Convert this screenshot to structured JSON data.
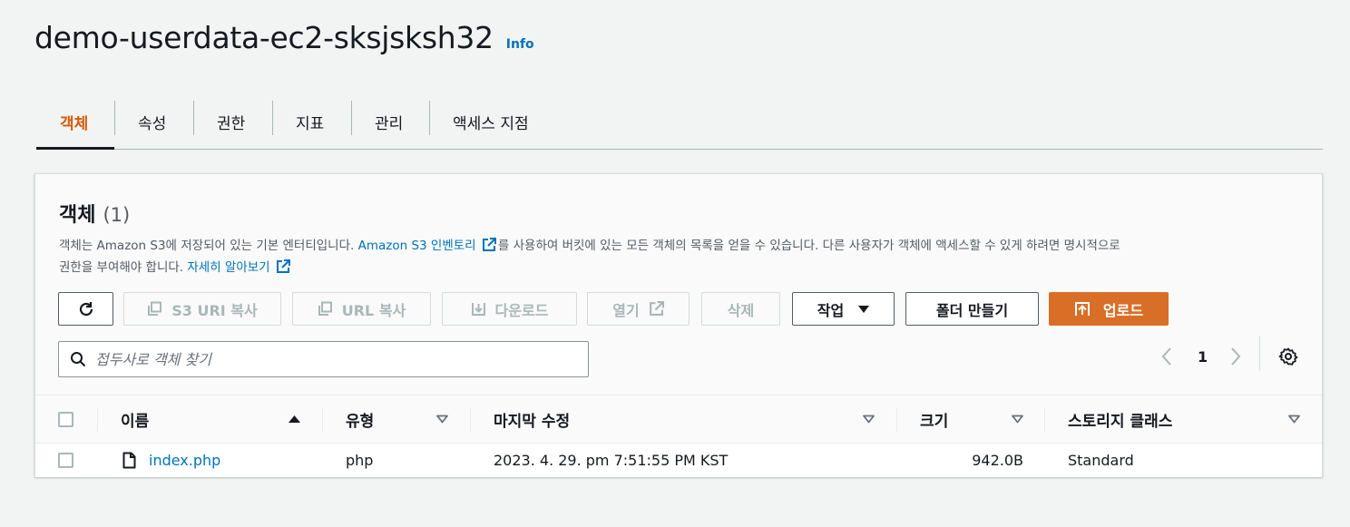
{
  "header": {
    "title": "demo-userdata-ec2-sksjsksh32",
    "info_link": "Info"
  },
  "tabs": [
    {
      "label": "객체",
      "active": true
    },
    {
      "label": "속성",
      "active": false
    },
    {
      "label": "권한",
      "active": false
    },
    {
      "label": "지표",
      "active": false
    },
    {
      "label": "관리",
      "active": false
    },
    {
      "label": "액세스 지점",
      "active": false
    }
  ],
  "objects_panel": {
    "title": "객체",
    "count": "(1)",
    "description": {
      "part1": "객체는 Amazon S3에 저장되어 있는 기본 엔터티입니다. ",
      "inventory_link": "Amazon S3 인벤토리",
      "part2": "를 사용하여 버킷에 있는 모든 객체의 목록을 얻을 수 있습니다. 다른 사용자가 객체에 액세스할 수 있게 하려면 명시적으로",
      "part3": "권한을 부여해야 합니다. ",
      "learn_more_link": "자세히 알아보기"
    }
  },
  "toolbar": {
    "refresh_icon": "refresh-icon",
    "copy_s3_uri": "S3 URI 복사",
    "copy_url": "URL 복사",
    "download": "다운로드",
    "open": "열기",
    "delete": "삭제",
    "actions": "작업",
    "create_folder": "폴더 만들기",
    "upload": "업로드"
  },
  "search": {
    "placeholder": "접두사로 객체 찾기",
    "value": ""
  },
  "pagination": {
    "current_page": "1"
  },
  "table": {
    "columns": [
      "이름",
      "유형",
      "마지막 수정",
      "크기",
      "스토리지 클래스"
    ],
    "rows": [
      {
        "name": "index.php",
        "type": "php",
        "last_modified": "2023. 4. 29. pm 7:51:55 PM KST",
        "size": "942.0B",
        "storage_class": "Standard"
      }
    ]
  },
  "colors": {
    "accent": "#d45b07",
    "link": "#0073bb",
    "primary_button": "#d96f27"
  }
}
